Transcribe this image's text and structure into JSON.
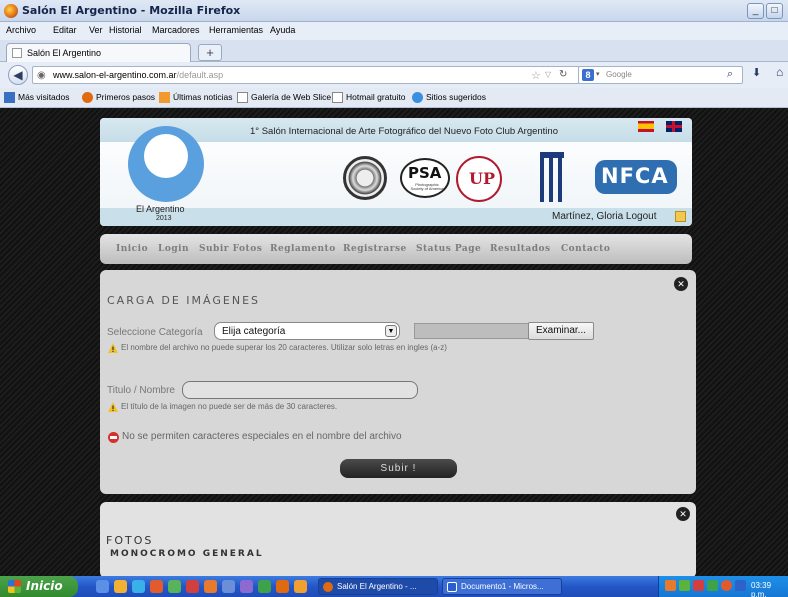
{
  "window": {
    "title": "Salón El Argentino - Mozilla Firefox",
    "controls": {
      "minimize": "_",
      "maximize": "□",
      "close": "×"
    }
  },
  "menubar": [
    "Archivo",
    "Editar",
    "Ver",
    "Historial",
    "Marcadores",
    "Herramientas",
    "Ayuda"
  ],
  "tabs": [
    {
      "label": "Salón El Argentino"
    }
  ],
  "new_tab": "+",
  "navbar": {
    "url_host": "www.salon-el-argentino.com.ar",
    "url_path": "/default.asp",
    "search_engine": "8",
    "search_placeholder": "Google"
  },
  "bookmarks": [
    {
      "label": "Más visitados",
      "icon": "bookmark-icon",
      "color": "#3b6fc4"
    },
    {
      "label": "Primeros pasos",
      "icon": "firefox-icon",
      "color": "#e06a10"
    },
    {
      "label": "Últimas noticias",
      "icon": "rss-icon",
      "color": "#f29a2e"
    },
    {
      "label": "Galería de Web Slice",
      "icon": "page-icon",
      "color": "#ffffff"
    },
    {
      "label": "Hotmail gratuito",
      "icon": "page-icon",
      "color": "#ffffff"
    },
    {
      "label": "Sitios sugeridos",
      "icon": "ie-icon",
      "color": "#3b8fe0"
    }
  ],
  "header": {
    "title": "1° Salón Internacional de Arte Fotográfico del Nuevo Foto Club Argentino",
    "logo_name": "El Argentino",
    "logo_year": "2013",
    "user": "Martínez, Gloria Logout",
    "psa": "PSA",
    "psa_sub": "Photographic Society of America",
    "up": "UP",
    "nfca": "NFCA"
  },
  "nav": [
    "Inicio",
    "Login",
    "Subir Fotos",
    "Reglamento",
    "Registrarse",
    "Status Page",
    "Resultados",
    "Contacto"
  ],
  "upload": {
    "heading": "CARGA DE IMÁGENES",
    "category_label": "Seleccione Categoría",
    "category_value": "Elija categoría",
    "browse": "Examinar...",
    "filename_hint": "El nombre del archivo no puede superar los 20 caracteres. Utilizar solo letras en ingles (a-z)",
    "title_label": "Titulo / Nombre",
    "title_value": "",
    "title_hint": "El título de la imagen no puede ser de más de 30 caracteres.",
    "special_chars": "No se permiten caracteres especiales en el nombre del archivo",
    "submit": "Subir !"
  },
  "photos": {
    "heading": "FOTOS",
    "subheading": "MONOCROMO GENERAL"
  },
  "taskbar": {
    "start": "Inicio",
    "tasks": [
      {
        "label": "Salón El Argentino - ...",
        "active": true
      },
      {
        "label": "Documento1 - Micros...",
        "active": false
      }
    ],
    "clock": "03:39 p.m."
  },
  "colors": {
    "page_bg": "#161616",
    "header_band": "#c9e0ea",
    "logo_blue": "#5aa0de",
    "panel": "#d7d7d7",
    "taskbar": "#2456c6",
    "start": "#318a2e"
  }
}
